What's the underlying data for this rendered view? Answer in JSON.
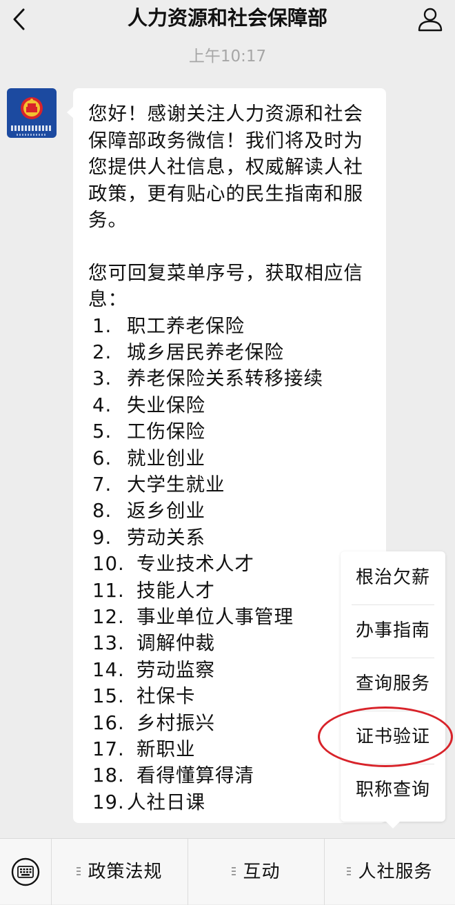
{
  "header": {
    "title": "人力资源和社会保障部"
  },
  "chat": {
    "timestamp": "上午10:17",
    "message": {
      "greeting": "您好！感谢关注人力资源和社会保障部政务微信！我们将及时为您提供人社信息，权威解读人社政策，更有贴心的民生指南和服务。",
      "prompt": "您可回复菜单序号，获取相应信息：",
      "items": [
        {
          "num": "1.",
          "label": "职工养老保险"
        },
        {
          "num": "2.",
          "label": "城乡居民养老保险"
        },
        {
          "num": "3.",
          "label": "养老保险关系转移接续"
        },
        {
          "num": "4.",
          "label": "失业保险"
        },
        {
          "num": "5.",
          "label": "工伤保险"
        },
        {
          "num": "6.",
          "label": "就业创业"
        },
        {
          "num": "7.",
          "label": "大学生就业"
        },
        {
          "num": "8.",
          "label": "返乡创业"
        },
        {
          "num": "9.",
          "label": "劳动关系"
        },
        {
          "num": "10.",
          "label": "专业技术人才"
        },
        {
          "num": "11.",
          "label": "技能人才"
        },
        {
          "num": "12.",
          "label": "事业单位人事管理"
        },
        {
          "num": "13.",
          "label": "调解仲裁"
        },
        {
          "num": "14.",
          "label": "劳动监察"
        },
        {
          "num": "15.",
          "label": "社保卡"
        },
        {
          "num": "16.",
          "label": "乡村振兴"
        },
        {
          "num": "17.",
          "label": "新职业"
        },
        {
          "num": "18.",
          "label": "看得懂算得清"
        },
        {
          "num": "19.",
          "label": "人社日课"
        }
      ]
    }
  },
  "popup_menu": {
    "items": [
      "根治欠薪",
      "办事指南",
      "查询服务",
      "证书验证",
      "职称查询"
    ],
    "highlight_color": "#d8232a"
  },
  "bottom_menu": {
    "tabs": [
      "政策法规",
      "互动",
      "人社服务"
    ]
  }
}
